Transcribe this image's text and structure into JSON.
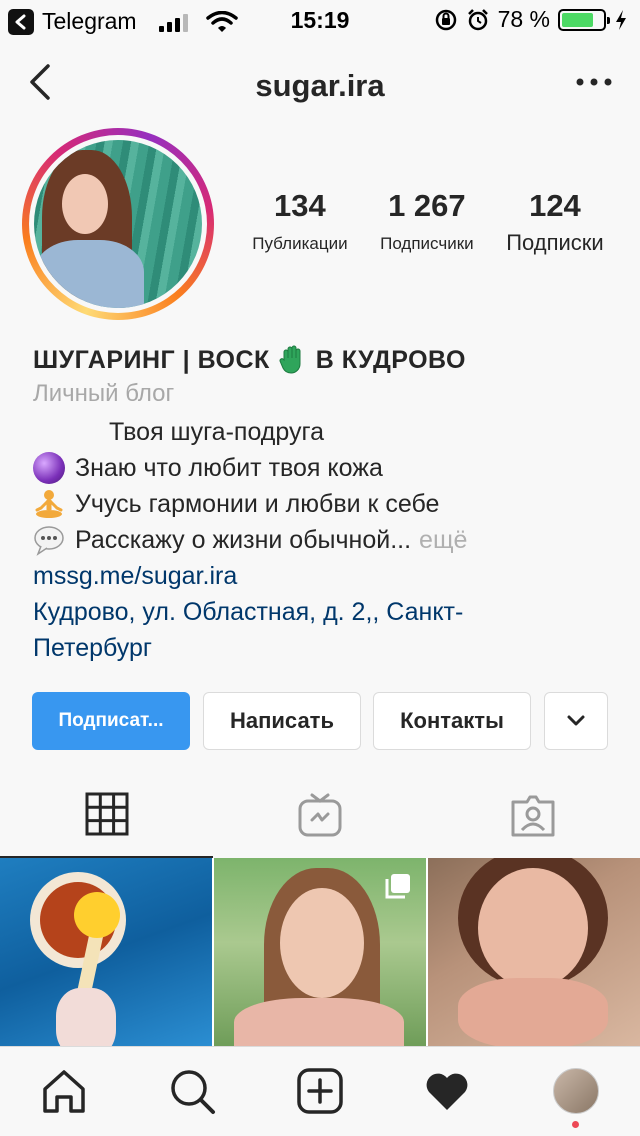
{
  "status_bar": {
    "app_name": "Telegram",
    "time": "15:19",
    "battery_percent": "78 %",
    "battery_level": 0.78,
    "battery_color": "#4cd964"
  },
  "header": {
    "username": "sugar.ira",
    "back_icon": "chevron-left-icon",
    "more_icon": "more-horizontal-icon"
  },
  "profile": {
    "stats": [
      {
        "value": "134",
        "label": "Публикации"
      },
      {
        "value": "1 267",
        "label": "Подписчики"
      },
      {
        "value": "124",
        "label": "Подписки"
      }
    ],
    "name": "ШУГАРИНГ | ВОСК",
    "name_suffix": "В КУДРОВО",
    "category": "Личный блог",
    "bio_lines": [
      "Твоя шуга-подруга",
      "Знаю что любит твоя кожа",
      "Учусь гармонии и любви к себе",
      "Расскажу о жизни обычной..."
    ],
    "more_label": "ещё",
    "link": "mssg.me/sugar.ira",
    "address": "Кудрово, ул. Областная, д. 2,, Санкт-Петербург"
  },
  "actions": {
    "follow_label": "Подписат...",
    "message_label": "Написать",
    "contacts_label": "Контакты",
    "follow_color": "#3897f0"
  },
  "tabs": [
    {
      "icon": "grid-icon",
      "active": true
    },
    {
      "icon": "igtv-icon",
      "active": false
    },
    {
      "icon": "tagged-icon",
      "active": false
    }
  ],
  "bottom_nav": [
    {
      "icon": "home-icon"
    },
    {
      "icon": "search-icon"
    },
    {
      "icon": "add-post-icon"
    },
    {
      "icon": "heart-icon"
    },
    {
      "icon": "profile-avatar-icon"
    }
  ]
}
